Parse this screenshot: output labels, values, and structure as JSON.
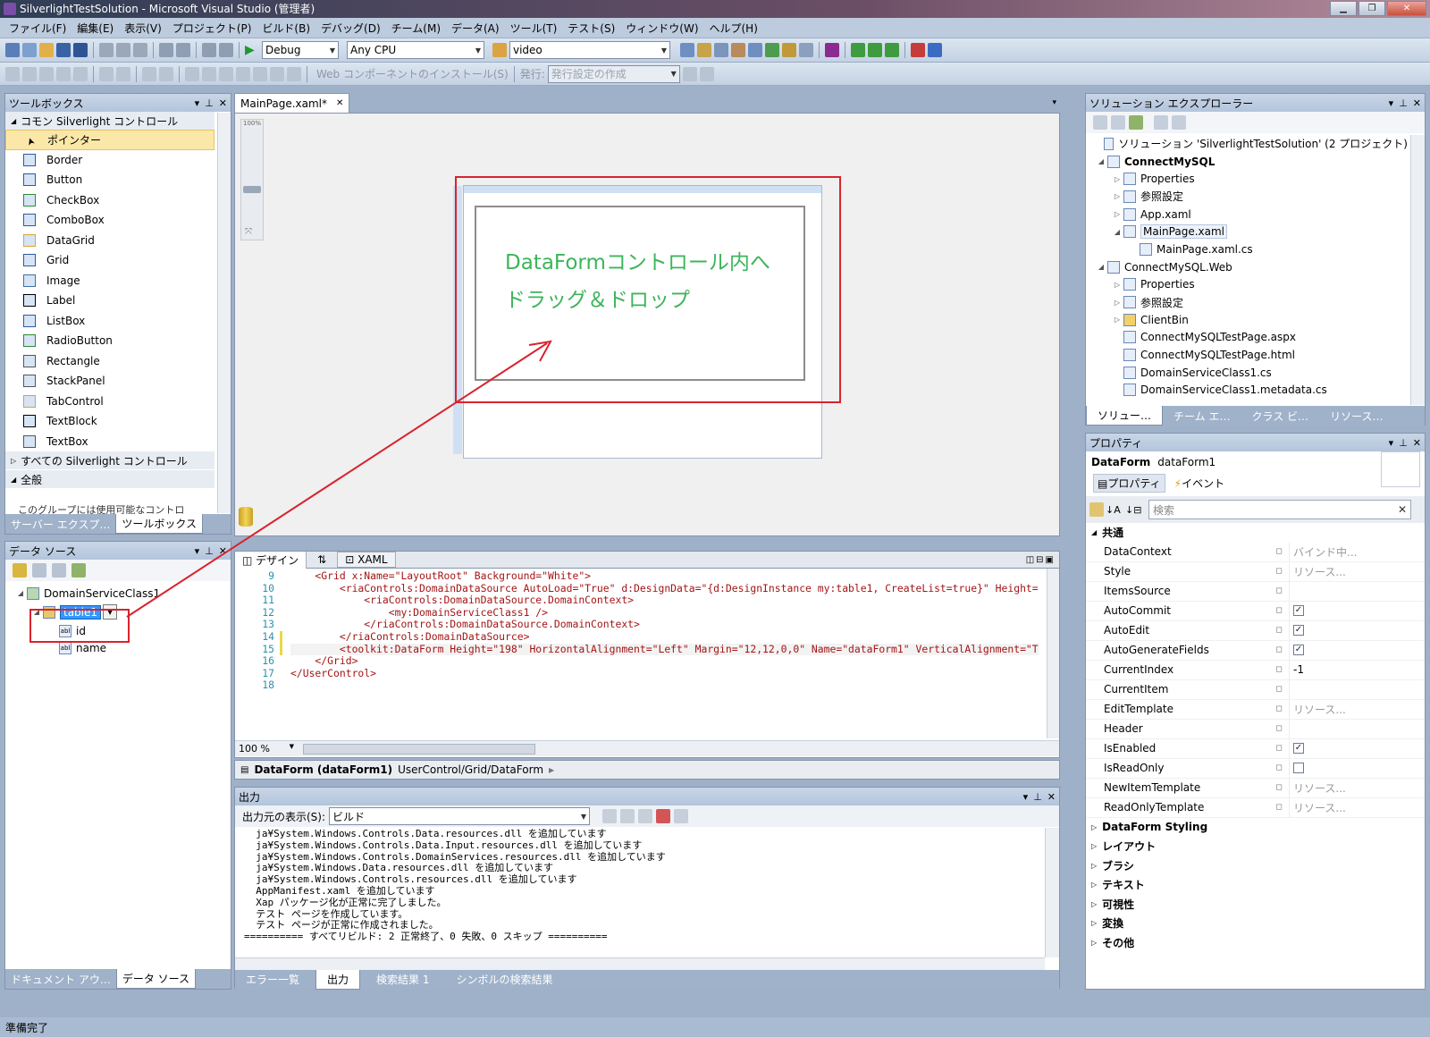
{
  "window": {
    "title": "SilverlightTestSolution - Microsoft Visual Studio (管理者)"
  },
  "menu": [
    "ファイル(F)",
    "編集(E)",
    "表示(V)",
    "プロジェクト(P)",
    "ビルド(B)",
    "デバッグ(D)",
    "チーム(M)",
    "データ(A)",
    "ツール(T)",
    "テスト(S)",
    "ウィンドウ(W)",
    "ヘルプ(H)"
  ],
  "toolbar": {
    "config": "Debug",
    "platform": "Any CPU",
    "find": "video",
    "web_install": "Web コンポーネントのインストール(S)",
    "publish_label": "発行:",
    "publish_combo": "発行設定の作成"
  },
  "toolbox": {
    "title": "ツールボックス",
    "category_common": "コモン Silverlight コントロール",
    "items": [
      "ポインター",
      "Border",
      "Button",
      "CheckBox",
      "ComboBox",
      "DataGrid",
      "Grid",
      "Image",
      "Label",
      "ListBox",
      "RadioButton",
      "Rectangle",
      "StackPanel",
      "TabControl",
      "TextBlock",
      "TextBox"
    ],
    "category_all": "すべての Silverlight コントロール",
    "category_general": "全般",
    "note": "このグループには使用可能なコントロ",
    "tab_server": "サーバー エクスプ…",
    "tab_toolbox": "ツールボックス"
  },
  "datasource": {
    "title": "データ ソース",
    "root": "DomainServiceClass1",
    "table": "table1",
    "fields": [
      "id",
      "name"
    ],
    "tab_doc": "ドキュメント アウ…",
    "tab_ds": "データ ソース"
  },
  "editor": {
    "tab": "MainPage.xaml*",
    "zoom_mark": "100%",
    "annotation_line1": "DataFormコントロール内へ",
    "annotation_line2": "ドラッグ＆ドロップ",
    "split_design": "デザイン",
    "split_swap": "⇅",
    "split_xaml": "XAML",
    "code_lines": [
      {
        "n": "9",
        "t": "    <Grid x:Name=\"LayoutRoot\" Background=\"White\">"
      },
      {
        "n": "10",
        "t": "        <riaControls:DomainDataSource AutoLoad=\"True\" d:DesignData=\"{d:DesignInstance my:table1, CreateList=true}\" Height="
      },
      {
        "n": "11",
        "t": "            <riaControls:DomainDataSource.DomainContext>"
      },
      {
        "n": "12",
        "t": "                <my:DomainServiceClass1 />"
      },
      {
        "n": "13",
        "t": "            </riaControls:DomainDataSource.DomainContext>"
      },
      {
        "n": "14",
        "t": "        </riaControls:DomainDataSource>"
      },
      {
        "n": "15",
        "t": "        <toolkit:DataForm Height=\"198\" HorizontalAlignment=\"Left\" Margin=\"12,12,0,0\" Name=\"dataForm1\" VerticalAlignment=\"T"
      },
      {
        "n": "16",
        "t": "    </Grid>"
      },
      {
        "n": "17",
        "t": "</UserControl>"
      },
      {
        "n": "18",
        "t": ""
      }
    ],
    "zoom": "100 %",
    "breadcrumb_element": "DataForm (dataForm1)",
    "breadcrumb_path": "UserControl/Grid/DataForm"
  },
  "output": {
    "title": "出力",
    "source_label": "出力元の表示(S):",
    "source_value": "ビルド",
    "lines": [
      "  ja¥System.Windows.Controls.Data.resources.dll を追加しています",
      "  ja¥System.Windows.Controls.Data.Input.resources.dll を追加しています",
      "  ja¥System.Windows.Controls.DomainServices.resources.dll を追加しています",
      "  ja¥System.Windows.Data.resources.dll を追加しています",
      "  ja¥System.Windows.Controls.resources.dll を追加しています",
      "  AppManifest.xaml を追加しています",
      "  Xap パッケージ化が正常に完了しました。",
      "  テスト ページを作成しています。",
      "  テスト ページが正常に作成されました。",
      "========== すべてリビルド: 2 正常終了、0 失敗、0 スキップ =========="
    ],
    "tabs": [
      "エラー一覧",
      "出力",
      "検索結果 1",
      "シンボルの検索結果"
    ]
  },
  "solution": {
    "title": "ソリューション エクスプローラー",
    "rows": [
      {
        "d": 0,
        "e": "",
        "t": "ソリューション 'SilverlightTestSolution' (2 プロジェクト)",
        "b": false
      },
      {
        "d": 0,
        "e": "◢",
        "t": "ConnectMySQL",
        "b": true
      },
      {
        "d": 1,
        "e": "▷",
        "t": "Properties",
        "b": false
      },
      {
        "d": 1,
        "e": "▷",
        "t": "参照設定",
        "b": false
      },
      {
        "d": 1,
        "e": "▷",
        "t": "App.xaml",
        "b": false
      },
      {
        "d": 1,
        "e": "◢",
        "t": "MainPage.xaml",
        "b": false
      },
      {
        "d": 2,
        "e": "",
        "t": "MainPage.xaml.cs",
        "b": false
      },
      {
        "d": 0,
        "e": "◢",
        "t": "ConnectMySQL.Web",
        "b": false
      },
      {
        "d": 1,
        "e": "▷",
        "t": "Properties",
        "b": false
      },
      {
        "d": 1,
        "e": "▷",
        "t": "参照設定",
        "b": false
      },
      {
        "d": 1,
        "e": "▷",
        "t": "ClientBin",
        "b": false
      },
      {
        "d": 1,
        "e": "",
        "t": "ConnectMySQLTestPage.aspx",
        "b": false
      },
      {
        "d": 1,
        "e": "",
        "t": "ConnectMySQLTestPage.html",
        "b": false
      },
      {
        "d": 1,
        "e": "",
        "t": "DomainServiceClass1.cs",
        "b": false
      },
      {
        "d": 1,
        "e": "",
        "t": "DomainServiceClass1.metadata.cs",
        "b": false
      }
    ],
    "tabs": [
      "ソリュー…",
      "チーム エ…",
      "クラス ビ…",
      "リソース…"
    ]
  },
  "properties": {
    "title": "プロパティ",
    "type": "DataForm",
    "name": "dataForm1",
    "tab_props": "プロパティ",
    "tab_events": "イベント",
    "search_placeholder": "検索",
    "category_common": "共通",
    "rows": [
      {
        "n": "DataContext",
        "v": "バインド中...",
        "c": null
      },
      {
        "n": "Style",
        "v": "リソース...",
        "c": null
      },
      {
        "n": "ItemsSource",
        "v": "",
        "c": null
      },
      {
        "n": "AutoCommit",
        "v": "",
        "c": true
      },
      {
        "n": "AutoEdit",
        "v": "",
        "c": true
      },
      {
        "n": "AutoGenerateFields",
        "v": "",
        "c": true
      },
      {
        "n": "CurrentIndex",
        "v": "-1",
        "c": null
      },
      {
        "n": "CurrentItem",
        "v": "",
        "c": null
      },
      {
        "n": "EditTemplate",
        "v": "リソース...",
        "c": null
      },
      {
        "n": "Header",
        "v": "",
        "c": null
      },
      {
        "n": "IsEnabled",
        "v": "",
        "c": true
      },
      {
        "n": "IsReadOnly",
        "v": "",
        "c": false
      },
      {
        "n": "NewItemTemplate",
        "v": "リソース...",
        "c": null
      },
      {
        "n": "ReadOnlyTemplate",
        "v": "リソース...",
        "c": null
      }
    ],
    "categories": [
      "DataForm Styling",
      "レイアウト",
      "ブラシ",
      "テキスト",
      "可視性",
      "変換",
      "その他"
    ]
  },
  "status": "準備完了",
  "colors": {
    "annotation_red": "#d9232d",
    "annotation_green": "#3cb55a",
    "selection_blue": "#3399ff"
  }
}
